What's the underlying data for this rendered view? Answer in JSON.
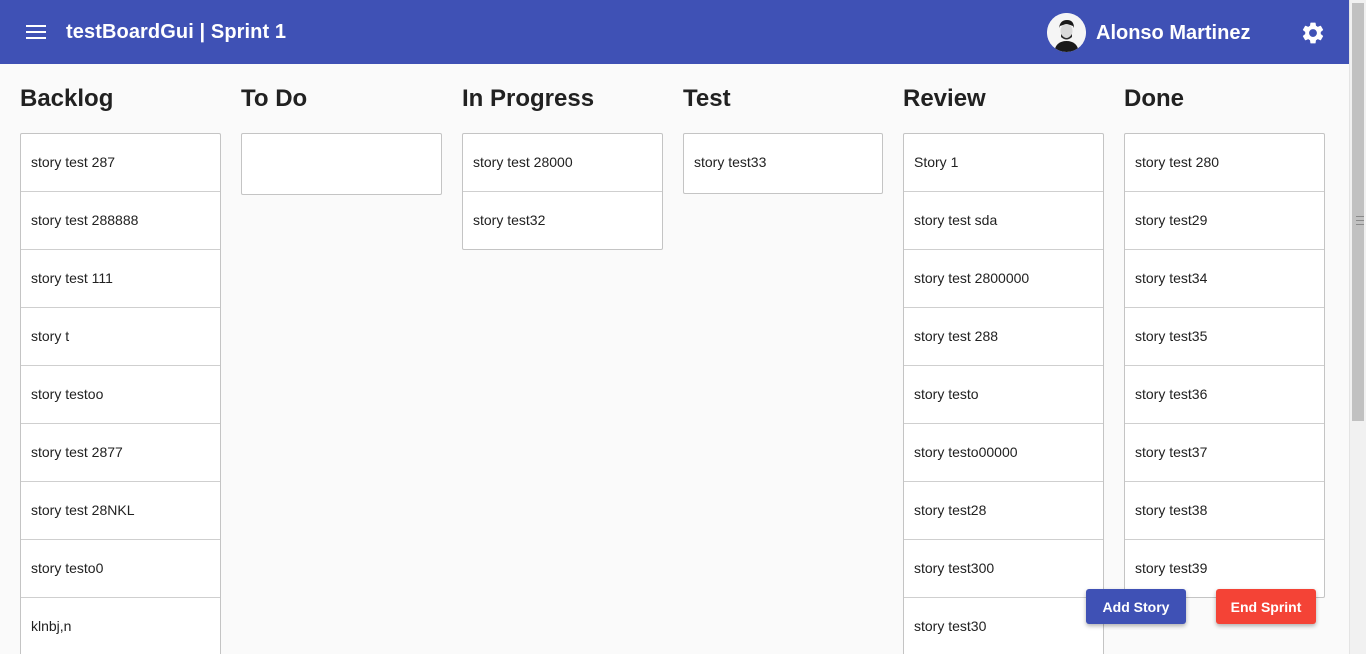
{
  "header": {
    "title": "testBoardGui | Sprint 1",
    "user_name": "Alonso Martinez",
    "menu_icon": "hamburger-menu-icon",
    "settings_icon": "gear-icon",
    "bg_color": "#3f51b5"
  },
  "columns": [
    {
      "title": "Backlog",
      "stories": [
        "story test 287",
        "story test 288888",
        "story test 111",
        "story t",
        "story testoo",
        "story test 2877",
        "story test 28NKL",
        "story testo0",
        "klnbj,n"
      ]
    },
    {
      "title": "To Do",
      "stories": []
    },
    {
      "title": "In Progress",
      "stories": [
        "story test 28000",
        "story test32"
      ]
    },
    {
      "title": "Test",
      "stories": [
        "story test33"
      ]
    },
    {
      "title": "Review",
      "stories": [
        "Story 1",
        "story test sda",
        "story test 2800000",
        "story test 288",
        "story testo",
        "story testo00000",
        "story test28",
        "story test300",
        "story test30"
      ]
    },
    {
      "title": "Done",
      "stories": [
        "story test 280",
        "story test29",
        "story test34",
        "story test35",
        "story test36",
        "story test37",
        "story test38",
        "story test39"
      ]
    }
  ],
  "actions": {
    "add_story": "Add Story",
    "end_sprint": "End Sprint",
    "add_color": "#3f51b5",
    "end_color": "#f44336"
  }
}
